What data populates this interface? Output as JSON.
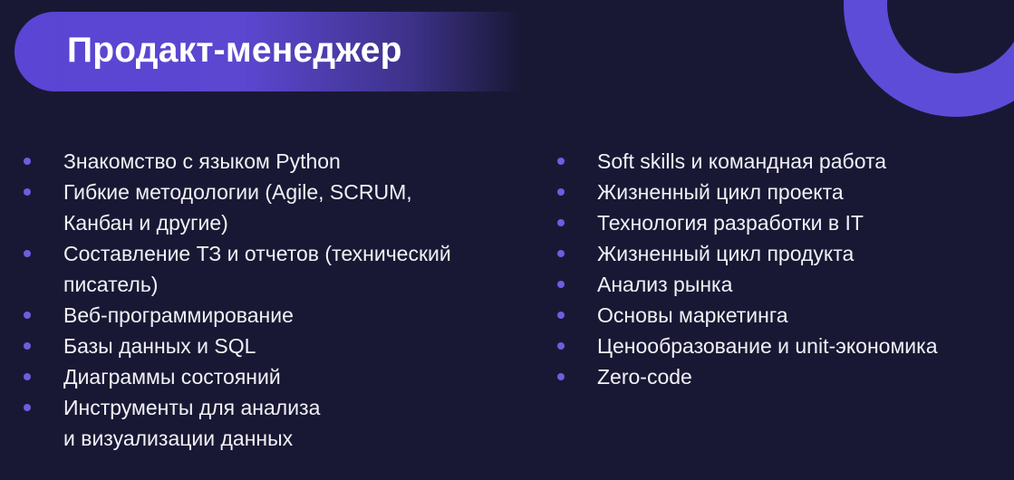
{
  "title": "Продакт-менеджер",
  "colors": {
    "background": "#191834",
    "accent": "#5a45d4",
    "bullet": "#6b5fe0",
    "text": "#f1f1f6"
  },
  "left_items": [
    [
      "Знакомство с языком Python"
    ],
    [
      "Гибкие методологии (Agile, SCRUM,",
      "Канбан и другие)"
    ],
    [
      "Составление ТЗ и отчетов (технический",
      "писатель)"
    ],
    [
      "Веб-программирование"
    ],
    [
      "Базы данных и SQL"
    ],
    [
      "Диаграммы состояний"
    ],
    [
      "Инструменты для анализа",
      "и визуализации данных"
    ]
  ],
  "right_items": [
    "Soft skills и командная работа",
    "Жизненный цикл проекта",
    "Технология разработки в IT",
    "Жизненный цикл продукта",
    "Анализ рынка",
    "Основы маркетинга",
    "Ценообразование и unit-экономика",
    "Zero-code"
  ]
}
